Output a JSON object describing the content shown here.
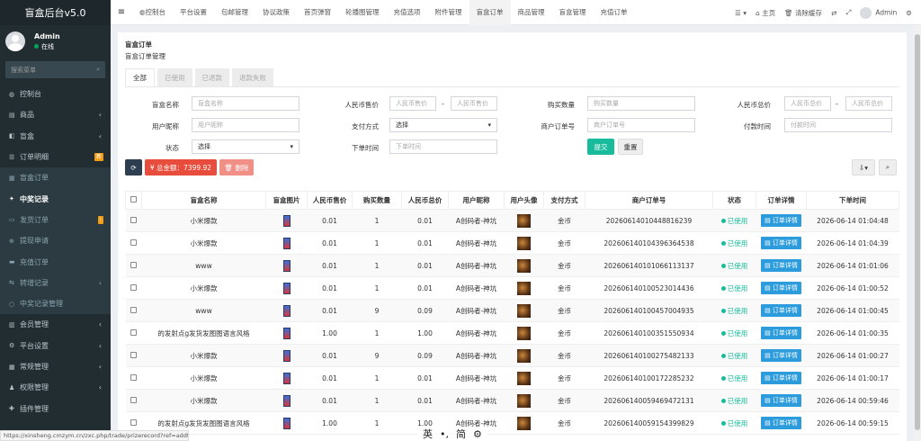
{
  "app_title": "盲盒后台v5.0",
  "user": {
    "name": "Admin",
    "status": "在线"
  },
  "sidebar": {
    "search_placeholder": "搜索菜单",
    "items": [
      {
        "label": "控制台",
        "icon": "dashboard-icon",
        "arrow": "",
        "badge": ""
      },
      {
        "label": "商品",
        "icon": "shop-icon",
        "arrow": "‹",
        "badge": ""
      },
      {
        "label": "盲盒",
        "icon": "box-icon",
        "arrow": "‹",
        "badge": ""
      },
      {
        "label": "订单明细",
        "icon": "order-icon",
        "arrow": "",
        "badge": "新"
      },
      {
        "label": "盲盒订单",
        "icon": "list-icon",
        "arrow": "",
        "badge": ""
      },
      {
        "label": "中奖记录",
        "icon": "gift-icon",
        "arrow": "",
        "badge": ""
      },
      {
        "label": "发货订单",
        "icon": "truck-icon",
        "arrow": "",
        "badge": "!"
      },
      {
        "label": "提现申请",
        "icon": "withdraw-icon",
        "arrow": "",
        "badge": ""
      },
      {
        "label": "充值订单",
        "icon": "recharge-icon",
        "arrow": "",
        "badge": ""
      },
      {
        "label": "转增记录",
        "icon": "transfer-icon",
        "arrow": "‹",
        "badge": ""
      },
      {
        "label": "中奖记录管理",
        "icon": "circle-icon",
        "arrow": "",
        "badge": ""
      },
      {
        "label": "会员管理",
        "icon": "member-icon",
        "arrow": "‹",
        "badge": ""
      },
      {
        "label": "平台设置",
        "icon": "gear-icon",
        "arrow": "‹",
        "badge": ""
      },
      {
        "label": "常规管理",
        "icon": "settings-icon",
        "arrow": "‹",
        "badge": ""
      },
      {
        "label": "权限管理",
        "icon": "users-icon",
        "arrow": "‹",
        "badge": ""
      },
      {
        "label": "插件管理",
        "icon": "plugin-icon",
        "arrow": "",
        "badge": ""
      }
    ]
  },
  "topnav": [
    "控制台",
    "平台设置",
    "包邮管理",
    "协议政策",
    "首页弹窗",
    "轮播图管理",
    "充值选项",
    "附件管理",
    "盲盒订单",
    "商品管理",
    "盲盒管理",
    "充值订单"
  ],
  "topright": {
    "home": "主页",
    "clear_cache": "清除缓存",
    "admin": "Admin"
  },
  "page": {
    "title": "盲盒订单",
    "subtitle": "盲盒订单管理"
  },
  "tabs": [
    "全部",
    "已使用",
    "已退款",
    "退款失败"
  ],
  "form": {
    "box_name_label": "盲盒名称",
    "box_name_ph": "盲盒名称",
    "price_label": "人民币售价",
    "price_min_ph": "人民币售价",
    "price_max_ph": "人民币售价",
    "qty_label": "购买数量",
    "qty_ph": "购买数量",
    "total_label": "人民币总价",
    "total_min_ph": "人民币总价",
    "total_max_ph": "人民币总价",
    "nick_label": "用户昵称",
    "nick_ph": "用户昵称",
    "pay_label": "支付方式",
    "pay_value": "选择",
    "merchant_label": "商户订单号",
    "merchant_ph": "商户订单号",
    "paytime_label": "付款时间",
    "paytime_ph": "付款时间",
    "status_label": "状态",
    "status_value": "选择",
    "ordertime_label": "下单时间",
    "ordertime_ph": "下单时间",
    "submit": "提交",
    "reset": "重置",
    "dash": "-"
  },
  "toolbar": {
    "total_label": "¥ 总金额：7399.92",
    "delete_label": "删除"
  },
  "table": {
    "headers": [
      "盲盒名称",
      "盲盒图片",
      "人民币售价",
      "购买数量",
      "人民币总价",
      "用户昵称",
      "用户头像",
      "支付方式",
      "商户订单号",
      "状态",
      "订单详情",
      "下单时间"
    ],
    "detail_label": "订单详情",
    "rows": [
      {
        "name": "小米爆款",
        "price": "0.01",
        "qty": "1",
        "total": "0.01",
        "nick": "A创码者-神坑",
        "pay": "金币",
        "order": "20260614010448816239",
        "status": "已使用",
        "time": "2026-06-14 01:04:48"
      },
      {
        "name": "小米爆款",
        "price": "0.01",
        "qty": "1",
        "total": "0.01",
        "nick": "A创码者-神坑",
        "pay": "金币",
        "order": "20260614010439636453​8",
        "status": "已使用",
        "time": "2026-06-14 01:04:39"
      },
      {
        "name": "www",
        "price": "0.01",
        "qty": "1",
        "total": "0.01",
        "nick": "A创码者-神坑",
        "pay": "金币",
        "order": "20260614010106611313​7",
        "status": "已使用",
        "time": "2026-06-14 01:01:06"
      },
      {
        "name": "小米爆款",
        "price": "0.01",
        "qty": "1",
        "total": "0.01",
        "nick": "A创码者-神坑",
        "pay": "金币",
        "order": "20260614010052301443​6",
        "status": "已使用",
        "time": "2026-06-14 01:00:52"
      },
      {
        "name": "www",
        "price": "0.01",
        "qty": "9",
        "total": "0.09",
        "nick": "A创码者-神坑",
        "pay": "金币",
        "order": "20260614010045700493​5",
        "status": "已使用",
        "time": "2026-06-14 01:00:45"
      },
      {
        "name": "的发射点g发货发图图语言风格",
        "price": "1.00",
        "qty": "1",
        "total": "1.00",
        "nick": "A创码者-神坑",
        "pay": "金币",
        "order": "20260614010035155093​4",
        "status": "已使用",
        "time": "2026-06-14 01:00:35"
      },
      {
        "name": "小米爆款",
        "price": "0.01",
        "qty": "9",
        "total": "0.09",
        "nick": "A创码者-神坑",
        "pay": "金币",
        "order": "20260614010027548213​3",
        "status": "已使用",
        "time": "2026-06-14 01:00:27"
      },
      {
        "name": "小米爆款",
        "price": "0.01",
        "qty": "1",
        "total": "0.01",
        "nick": "A创码者-神坑",
        "pay": "金币",
        "order": "20260614010017228523​2",
        "status": "已使用",
        "time": "2026-06-14 01:00:17"
      },
      {
        "name": "小米爆款",
        "price": "0.01",
        "qty": "1",
        "total": "0.01",
        "nick": "A创码者-神坑",
        "pay": "金币",
        "order": "20260614005946947213​1",
        "status": "已使用",
        "time": "2026-06-14 00:59:46"
      },
      {
        "name": "的发射点g发货发图图语言风格",
        "price": "1.00",
        "qty": "1",
        "total": "1.00",
        "nick": "A创码者-神坑",
        "pay": "金币",
        "order": "20260614005915439982​9",
        "status": "已使用",
        "time": "2026-06-14 00:59:15"
      }
    ]
  },
  "statusbar_url": "https://xinsheng.cmzym.cn/zxc.php/trade/prizerecord?ref=addtabs",
  "ime": {
    "a": "英",
    "b": "•,",
    "c": "简",
    "d": "⚙"
  }
}
